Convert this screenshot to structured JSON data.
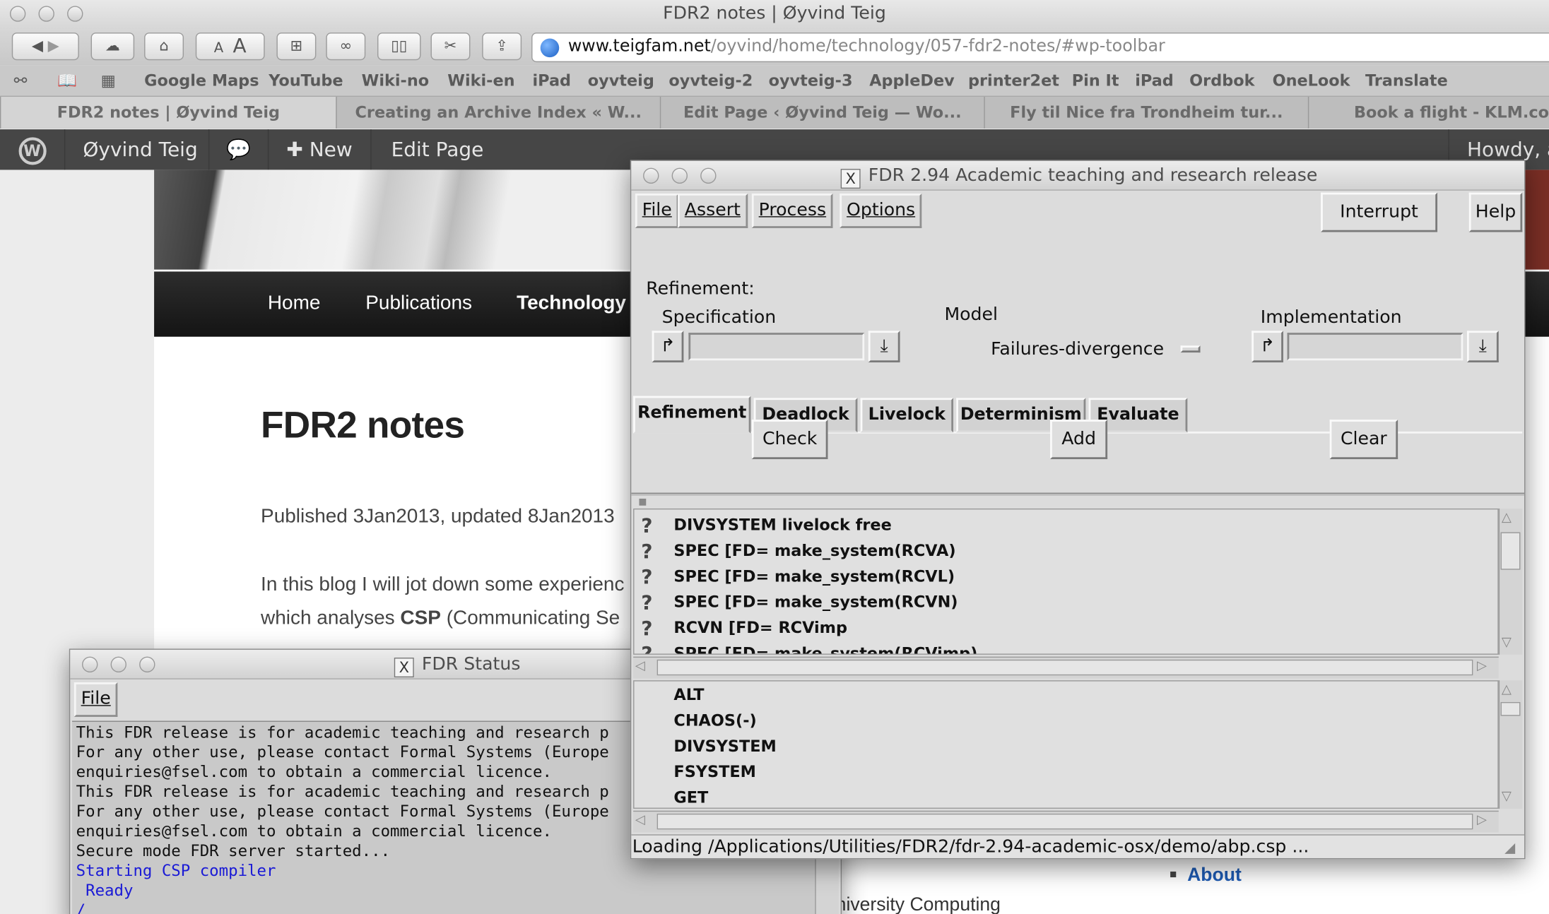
{
  "window_title": "FDR2 notes | Øyvind Teig",
  "url": {
    "domain": "www.teigfam.net",
    "path": "/oyvind/home/technology/057-fdr2-notes/#wp-toolbar"
  },
  "toolbar": {
    "font_small": "A",
    "font_large": "A"
  },
  "bookmarks": [
    "Google Maps",
    "YouTube",
    "Wiki-no",
    "Wiki-en",
    "iPad",
    "oyvteig",
    "oyvteig-2",
    "oyvteig-3",
    "AppleDev",
    "printer2et",
    "Pin It",
    "iPad",
    "Ordbok",
    "OneLook",
    "Translate"
  ],
  "tabs": [
    "FDR2 notes | Øyvind Teig",
    "Creating an Archive Index « W...",
    "Edit Page ‹ Øyvind Teig — Wo...",
    "Fly til Nice fra Trondheim tur...",
    "Book a flight - KLM.co"
  ],
  "wp_bar": {
    "site": "Øyvind Teig",
    "new": "New",
    "edit": "Edit Page",
    "howdy": "Howdy, a"
  },
  "site_nav": [
    "Home",
    "Publications",
    "Technology"
  ],
  "post": {
    "title": "FDR2 notes",
    "published": "Published 3Jan2013, updated 8Jan2013",
    "intro_line1": "In this blog I will jot down some experienc",
    "intro_line2_pre": "which analyses ",
    "intro_line2_bold": "CSP",
    "intro_line2_post": " (Communicating Se",
    "sidebar_link": "About",
    "footer_text": "niversity Computing"
  },
  "fdr_main": {
    "title": "FDR 2.94 Academic teaching and research release",
    "menus": [
      "File",
      "Assert",
      "Process",
      "Options"
    ],
    "interrupt": "Interrupt",
    "help": "Help",
    "tabs": [
      "Refinement",
      "Deadlock",
      "Livelock",
      "Determinism",
      "Evaluate"
    ],
    "active_tab": "Refinement",
    "section_label": "Refinement:",
    "spec_label": "Specification",
    "model_label": "Model",
    "model_value": "Failures-divergence",
    "impl_label": "Implementation",
    "check": "Check",
    "add": "Add",
    "clear": "Clear",
    "assertions": [
      "DIVSYSTEM livelock free",
      "SPEC [FD= make_system(RCVA)",
      "SPEC [FD= make_system(RCVL)",
      "SPEC [FD= make_system(RCVN)",
      "RCVN [FD= RCVimp",
      "SPEC [FD= make_system(RCVimp)"
    ],
    "assertion_status": "?",
    "processes": [
      "ALT",
      "CHAOS(-)",
      "DIVSYSTEM",
      "FSYSTEM",
      "GET"
    ],
    "status_line": "Loading /Applications/Utilities/FDR2/fdr-2.94-academic-osx/demo/abp.csp ..."
  },
  "fdr_status": {
    "title": "FDR Status",
    "menu_file": "File",
    "lines": [
      "This FDR release is for academic teaching and research p",
      "For any other use, please contact Formal Systems (Europe",
      "enquiries@fsel.com to obtain a commercial licence.",
      "This FDR release is for academic teaching and research p",
      "For any other use, please contact Formal Systems (Europe",
      "enquiries@fsel.com to obtain a commercial licence.",
      "Secure mode FDR server started..."
    ],
    "blue_lines": [
      "Starting CSP compiler",
      " Ready",
      "/"
    ]
  },
  "colors": {
    "link_blue": "#1e5bb3",
    "status_blue": "#1a1ad6",
    "wp_bar": "#464646"
  }
}
